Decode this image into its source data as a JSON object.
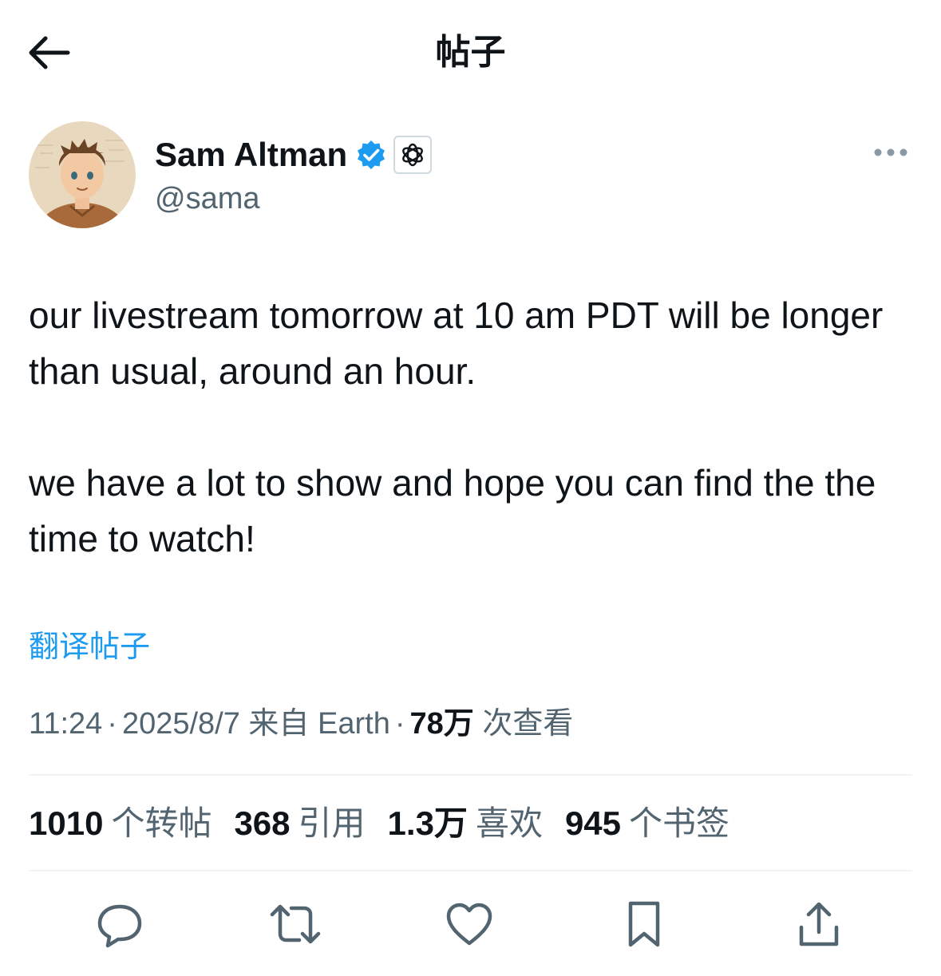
{
  "header": {
    "back_icon": "arrow-left-icon",
    "title": "帖子"
  },
  "author": {
    "display_name": "Sam Altman",
    "handle": "@sama",
    "verified_icon": "verified-badge-icon",
    "affiliation_icon": "openai-logo-icon",
    "more_icon": "more-horizontal-icon"
  },
  "tweet": {
    "paragraphs": [
      "our livestream tomorrow at 10 am PDT will be longer than usual, around an hour.",
      "we have a lot to show and hope you can find the the time to watch!"
    ],
    "translate_label": "翻译帖子"
  },
  "meta": {
    "time": "11:24",
    "date": "2025/8/7",
    "source_prefix": "来自",
    "source": "Earth",
    "views_count": "78万",
    "views_label": "次查看"
  },
  "stats": [
    {
      "count": "1010",
      "label": "个转帖"
    },
    {
      "count": "368",
      "label": "引用"
    },
    {
      "count": "1.3万",
      "label": "喜欢"
    },
    {
      "count": "945",
      "label": "个书签"
    }
  ],
  "actions": [
    {
      "icon": "reply-icon"
    },
    {
      "icon": "repost-icon"
    },
    {
      "icon": "like-icon"
    },
    {
      "icon": "bookmark-icon"
    },
    {
      "icon": "share-icon"
    }
  ],
  "colors": {
    "text": "#0f1419",
    "secondary": "#536471",
    "accent": "#1d9bf0",
    "divider": "#eff3f4"
  }
}
